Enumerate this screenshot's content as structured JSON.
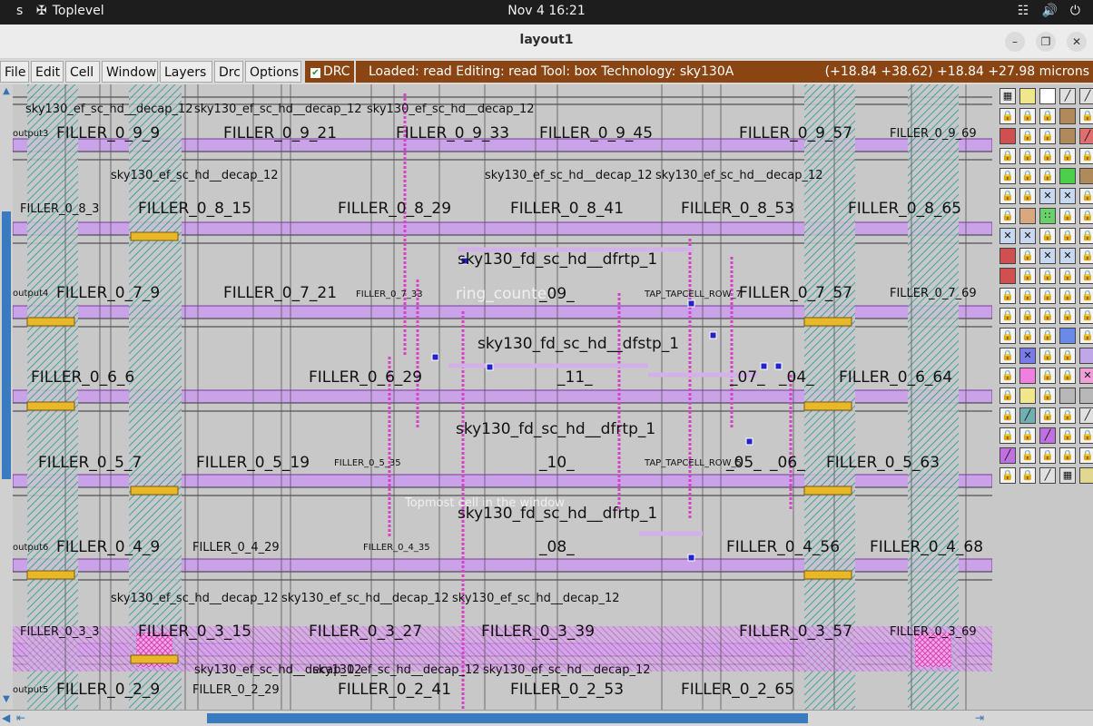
{
  "system_bar": {
    "activities": "s",
    "app_name": "Toplevel",
    "clock": "Nov 4  16:21"
  },
  "window": {
    "title": "layout1"
  },
  "menu": {
    "items": [
      "File",
      "Edit",
      "Cell",
      "Window",
      "Layers",
      "Drc",
      "Options"
    ],
    "drc_toggle": "DRC",
    "drc_checked": true
  },
  "status": {
    "text": "Loaded: read Editing: read Tool: box  Technology: sky130A",
    "coords": "(+18.84 +38.62) +18.84 +27.98 microns"
  },
  "colors": {
    "status_bg": "#8b4513",
    "scroll_accent": "#3a7bbf",
    "canvas_bg": "#c8c8c8",
    "metal_magenta": "#cc44cc",
    "row_purple": "#c9a2e8"
  },
  "canvas": {
    "cell_labels": [
      "sky130_ef_sc_hd__decap_12",
      "sky130_ef_sc_hd__decap_12",
      "sky130_ef_sc_hd__decap_12",
      "FILLER_0_9_9",
      "FILLER_0_9_21",
      "FILLER_0_9_33",
      "FILLER_0_9_45",
      "FILLER_0_9_57",
      "FILLER_0_9_69",
      "sky130_ef_sc_hd__decap_12",
      "sky130_ef_sc_hd__decap_12",
      "sky130_ef_sc_hd__decap_12",
      "FILLER_0_8_3",
      "FILLER_0_8_15",
      "FILLER_0_8_29",
      "FILLER_0_8_41",
      "FILLER_0_8_53",
      "FILLER_0_8_65",
      "sky130_fd_sc_hd__dfrtp_1",
      "ring_counter",
      "_09_",
      "FILLER_0_7_9",
      "FILLER_0_7_21",
      "FILLER_0_7_33",
      "FILLER_0_7_57",
      "FILLER_0_7_69",
      "TAP_TAPCELL_ROW_7",
      "sky130_fd_sc_hd__dfstp_1",
      "_11_",
      "FILLER_0_6_6",
      "FILLER_0_6_29",
      "FILLER_0_6_64",
      "_07_",
      "_04_",
      "sky130_fd_sc_hd__dfrtp_1",
      "_10_",
      "FILLER_0_5_7",
      "FILLER_0_5_19",
      "FILLER_0_5_35",
      "FILLER_0_5_63",
      "_05_",
      "_06_",
      "TAP_TAPCELL_ROW_5",
      "Topmost cell in the window",
      "sky130_fd_sc_hd__dfrtp_1",
      "_08_",
      "FILLER_0_4_9",
      "FILLER_0_4_29",
      "FILLER_0_4_35",
      "FILLER_0_4_56",
      "FILLER_0_4_68",
      "sky130_ef_sc_hd__decap_12",
      "sky130_ef_sc_hd__decap_12",
      "sky130_ef_sc_hd__decap_12",
      "FILLER_0_3_3",
      "FILLER_0_3_15",
      "FILLER_0_3_27",
      "FILLER_0_3_39",
      "FILLER_0_3_57",
      "FILLER_0_3_69",
      "sky130_ef_sc_hd__decap_12",
      "sky130_ef_sc_hd__decap_12",
      "sky130_ef_sc_hd__decap_12",
      "FILLER_0_2_9",
      "FILLER_0_2_29",
      "FILLER_0_2_41",
      "FILLER_0_2_53",
      "FILLER_0_2_65",
      "output3",
      "output4",
      "output6",
      "output5"
    ]
  },
  "palette": {
    "rows": [
      [
        "grid",
        "yellow",
        "white",
        "stripe",
        "stripe"
      ],
      [
        "lock",
        "lock",
        "lock",
        "brown",
        "lock"
      ],
      [
        "red",
        "lock",
        "lock",
        "brown",
        "red-stripe"
      ],
      [
        "lock",
        "lock",
        "lock",
        "lock",
        "lock"
      ],
      [
        "lock",
        "lock",
        "lock",
        "green",
        "brown"
      ],
      [
        "lock",
        "lock",
        "cross",
        "cross",
        "lock"
      ],
      [
        "lock",
        "tan",
        "green-dot",
        "lock",
        "lock"
      ],
      [
        "cross",
        "cross",
        "lock",
        "lock",
        "lock"
      ],
      [
        "red",
        "lock",
        "cross",
        "cross",
        "lock"
      ],
      [
        "red",
        "lock",
        "lock",
        "lock",
        "lock"
      ],
      [
        "lock",
        "lock",
        "lock",
        "lock",
        "lock"
      ],
      [
        "lock",
        "lock",
        "lock",
        "lock",
        "lock"
      ],
      [
        "lock",
        "lock",
        "lock",
        "blue",
        "lock"
      ],
      [
        "lock",
        "blue-x",
        "lock",
        "lock",
        "lavender"
      ],
      [
        "lock",
        "pink",
        "lock",
        "lock",
        "pink-x"
      ],
      [
        "lock",
        "yellow",
        "lock",
        "grey",
        "grey"
      ],
      [
        "lock",
        "teal",
        "lock",
        "lock",
        "stripe"
      ],
      [
        "lock",
        "lock",
        "violet",
        "lock",
        "lock"
      ],
      [
        "violet",
        "lock",
        "lock",
        "lock",
        "lock"
      ],
      [
        "lock",
        "lock",
        "stripe",
        "check",
        "khaki"
      ]
    ]
  }
}
